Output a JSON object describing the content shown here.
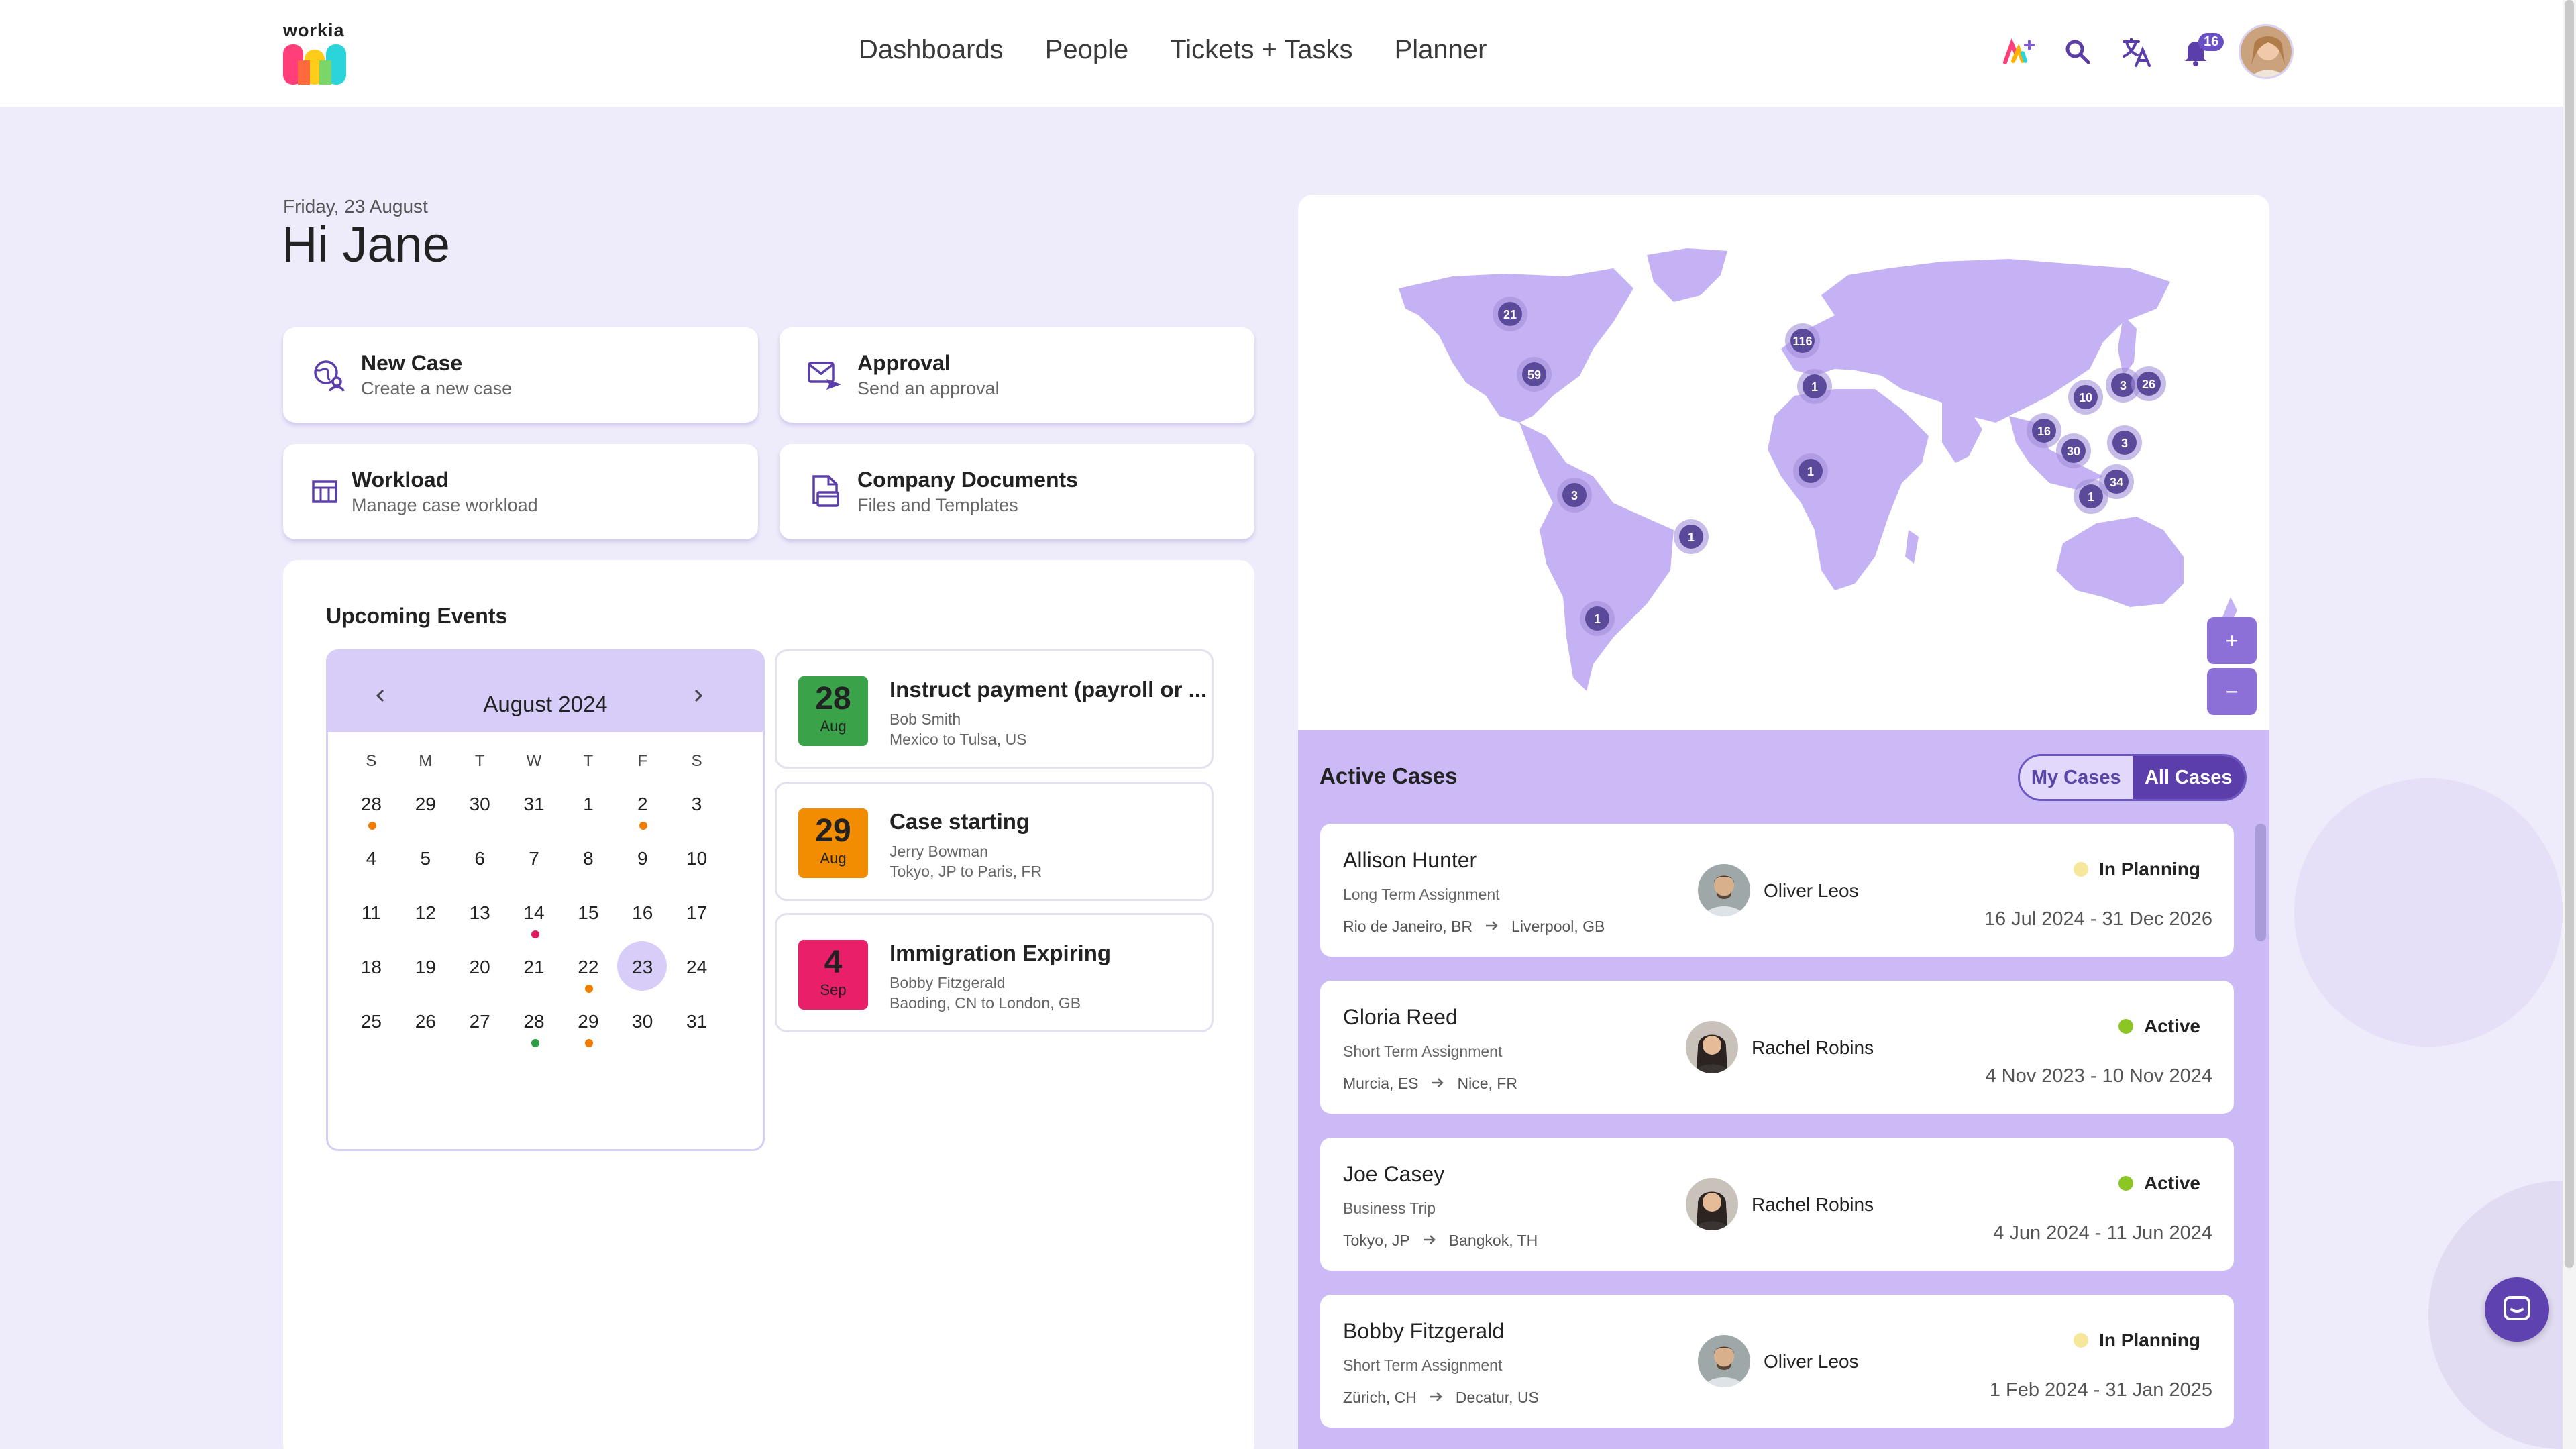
{
  "app": {
    "logo_text": "workia"
  },
  "nav": {
    "items": [
      "Dashboards",
      "People",
      "Tickets + Tasks",
      "Planner"
    ]
  },
  "header": {
    "icons": [
      "ai-sparkle-icon",
      "search-icon",
      "translate-icon",
      "bell-icon"
    ],
    "notification_count": "16"
  },
  "greeting": {
    "date": "Friday, 23 August",
    "title": "Hi Jane"
  },
  "quick_actions": [
    {
      "title": "New Case",
      "subtitle": "Create a new case",
      "icon": "globe-person-icon"
    },
    {
      "title": "Approval",
      "subtitle": "Send an approval",
      "icon": "mail-send-icon"
    },
    {
      "title": "Workload",
      "subtitle": "Manage case workload",
      "icon": "table-icon"
    },
    {
      "title": "Company Documents",
      "subtitle": "Files and Templates",
      "icon": "documents-icon"
    }
  ],
  "events": {
    "title": "Upcoming Events",
    "calendar": {
      "month": "August 2024",
      "weekdays": [
        "S",
        "M",
        "T",
        "W",
        "T",
        "F",
        "S"
      ],
      "weeks": [
        [
          "28",
          "29",
          "30",
          "31",
          "1",
          "2",
          "3"
        ],
        [
          "4",
          "5",
          "6",
          "7",
          "8",
          "9",
          "10"
        ],
        [
          "11",
          "12",
          "13",
          "14",
          "15",
          "16",
          "17"
        ],
        [
          "18",
          "19",
          "20",
          "21",
          "22",
          "23",
          "24"
        ],
        [
          "25",
          "26",
          "27",
          "28",
          "29",
          "30",
          "31"
        ]
      ],
      "selected": "23",
      "markers": [
        {
          "week": 0,
          "day": 0,
          "color": "#f07c00"
        },
        {
          "week": 0,
          "day": 5,
          "color": "#f07c00"
        },
        {
          "week": 2,
          "day": 3,
          "color": "#e0195f"
        },
        {
          "week": 3,
          "day": 4,
          "color": "#f07c00"
        },
        {
          "week": 4,
          "day": 3,
          "color": "#2e9e45"
        },
        {
          "week": 4,
          "day": 4,
          "color": "#f07c00"
        }
      ]
    },
    "items": [
      {
        "day": "28",
        "month": "Aug",
        "color": "#3aa34a",
        "title": "Instruct payment (payroll or ...",
        "person": "Bob Smith",
        "route": "Mexico to Tulsa, US"
      },
      {
        "day": "29",
        "month": "Aug",
        "color": "#f28c00",
        "title": "Case starting",
        "person": "Jerry Bowman",
        "route": "Tokyo, JP to Paris, FR"
      },
      {
        "day": "4",
        "month": "Sep",
        "color": "#ea1f6a",
        "title": "Immigration Expiring",
        "person": "Bobby Fitzgerald",
        "route": "Baoding, CN to London, GB"
      }
    ]
  },
  "map": {
    "clusters": [
      "21",
      "59",
      "116",
      "1",
      "10",
      "3",
      "26",
      "16",
      "30",
      "3",
      "1",
      "34",
      "1",
      "3",
      "1",
      "1"
    ],
    "zoom_in": "+",
    "zoom_out": "−"
  },
  "cases": {
    "title": "Active Cases",
    "toggle": {
      "mine": "My Cases",
      "all": "All Cases"
    },
    "items": [
      {
        "name": "Allison Hunter",
        "type": "Long Term Assignment",
        "from": "Rio de Janeiro, BR",
        "to": "Liverpool, GB",
        "manager": "Oliver Leos",
        "status": "In Planning",
        "status_color": "#f7e79a",
        "dates": "16 Jul 2024 - 31 Dec 2026"
      },
      {
        "name": "Gloria Reed",
        "type": "Short Term Assignment",
        "from": "Murcia, ES",
        "to": "Nice, FR",
        "manager": "Rachel Robins",
        "status": "Active",
        "status_color": "#8bc625",
        "dates": "4 Nov 2023 - 10 Nov 2024"
      },
      {
        "name": "Joe Casey",
        "type": "Business Trip",
        "from": "Tokyo, JP",
        "to": "Bangkok, TH",
        "manager": "Rachel Robins",
        "status": "Active",
        "status_color": "#8bc625",
        "dates": "4 Jun 2024 - 11 Jun 2024"
      },
      {
        "name": "Bobby Fitzgerald",
        "type": "Short Term Assignment",
        "from": "Zürich, CH",
        "to": "Decatur, US",
        "manager": "Oliver Leos",
        "status": "In Planning",
        "status_color": "#f7e79a",
        "dates": "1 Feb 2024 - 31 Jan 2025"
      }
    ]
  }
}
